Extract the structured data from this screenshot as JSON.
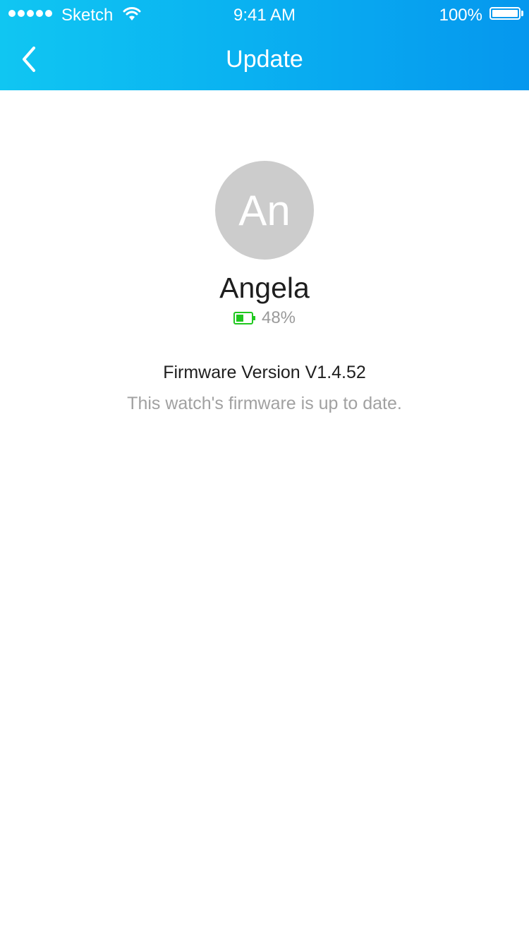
{
  "status_bar": {
    "carrier": "Sketch",
    "time": "9:41 AM",
    "battery": "100%",
    "signal_dots": 5
  },
  "nav": {
    "title": "Update",
    "back_icon": "chevron-left-icon"
  },
  "device": {
    "avatar_initials": "An",
    "name": "Angela",
    "battery_text": "48%",
    "battery_level": 0.48,
    "battery_color": "#20c81f"
  },
  "firmware": {
    "version_text": "Firmware Version V1.4.52",
    "status_text": "This watch's firmware is up to date."
  },
  "colors": {
    "header_start": "#10c6f2",
    "header_end": "#0597ee",
    "avatar_bg": "#cccccc"
  }
}
